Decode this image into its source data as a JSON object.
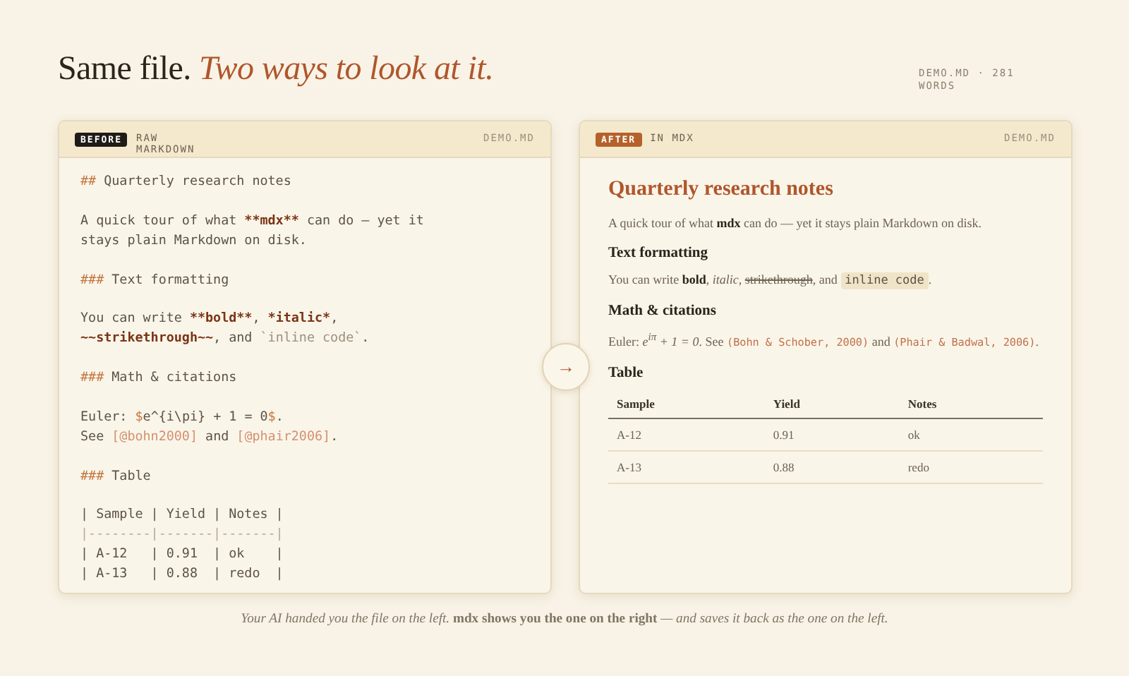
{
  "title": {
    "plain": "Same file.",
    "accent": "Two ways to look at it."
  },
  "meta": "DEMO.MD · 281 WORDS",
  "raw_panel": {
    "badge": {
      "text": "BEFORE",
      "kind": "before"
    },
    "label": "RAW MARKDOWN",
    "file": "DEMO.MD",
    "blocks": [
      {
        "lines": [
          [
            {
              "kind": "mark",
              "text": "## "
            },
            {
              "kind": "plain",
              "text": "Quarterly research notes"
            }
          ]
        ]
      },
      {
        "lines": [
          [
            {
              "kind": "plain",
              "text": "A quick tour of what "
            },
            {
              "kind": "strong",
              "text": "**mdx**"
            },
            {
              "kind": "plain",
              "text": " can do — yet it"
            }
          ],
          [
            {
              "kind": "plain",
              "text": "stays plain Markdown on disk."
            }
          ]
        ]
      },
      {
        "lines": [
          [
            {
              "kind": "mark",
              "text": "### "
            },
            {
              "kind": "plain",
              "text": "Text formatting"
            }
          ]
        ]
      },
      {
        "lines": [
          [
            {
              "kind": "plain",
              "text": "You can write "
            },
            {
              "kind": "strong",
              "text": "**bold**"
            },
            {
              "kind": "plain",
              "text": ", "
            },
            {
              "kind": "strong",
              "text": "*italic*"
            },
            {
              "kind": "plain",
              "text": ","
            }
          ],
          [
            {
              "kind": "strong",
              "text": "~~strikethrough~~"
            },
            {
              "kind": "plain",
              "text": ", and "
            },
            {
              "kind": "code",
              "text": "`inline code`"
            },
            {
              "kind": "plain",
              "text": "."
            }
          ]
        ]
      },
      {
        "lines": [
          [
            {
              "kind": "mark",
              "text": "### "
            },
            {
              "kind": "plain",
              "text": "Math & citations"
            }
          ]
        ]
      },
      {
        "lines": [
          [
            {
              "kind": "plain",
              "text": "Euler: "
            },
            {
              "kind": "mark",
              "text": "$"
            },
            {
              "kind": "plain",
              "text": "e^{i\\pi} + 1 = 0"
            },
            {
              "kind": "mark",
              "text": "$"
            },
            {
              "kind": "plain",
              "text": "."
            }
          ],
          [
            {
              "kind": "plain",
              "text": "See "
            },
            {
              "kind": "cite",
              "text": "[@bohn2000]"
            },
            {
              "kind": "plain",
              "text": " and "
            },
            {
              "kind": "cite",
              "text": "[@phair2006]"
            },
            {
              "kind": "plain",
              "text": "."
            }
          ]
        ]
      },
      {
        "lines": [
          [
            {
              "kind": "mark",
              "text": "### "
            },
            {
              "kind": "plain",
              "text": "Table"
            }
          ]
        ]
      },
      {
        "lines": [
          [
            {
              "kind": "plain",
              "text": "| Sample | Yield | Notes |"
            }
          ],
          [
            {
              "kind": "rule",
              "text": "|--------|-------|-------|"
            }
          ],
          [
            {
              "kind": "plain",
              "text": "| A-12   | 0.91  | ok    |"
            }
          ],
          [
            {
              "kind": "plain",
              "text": "| A-13   | 0.88  | redo  |"
            }
          ]
        ]
      }
    ]
  },
  "arrow": "→",
  "rendered_panel": {
    "badge": {
      "text": "AFTER",
      "kind": "after"
    },
    "label": "IN MDX",
    "file": "DEMO.MD",
    "heading": "Quarterly research notes",
    "blocks": [
      {
        "kind": "para",
        "parts": [
          {
            "kind": "text",
            "text": "A quick tour of what "
          },
          {
            "kind": "bold",
            "text": "mdx"
          },
          {
            "kind": "text",
            "text": " can do — yet it stays plain Markdown on disk."
          }
        ]
      },
      {
        "kind": "subheading",
        "text": "Text formatting"
      },
      {
        "kind": "para",
        "parts": [
          {
            "kind": "text",
            "text": "You can write "
          },
          {
            "kind": "bold",
            "text": "bold"
          },
          {
            "kind": "text",
            "text": ", "
          },
          {
            "kind": "italic",
            "text": "italic"
          },
          {
            "kind": "text",
            "text": ", "
          },
          {
            "kind": "strike",
            "text": "strikethrough"
          },
          {
            "kind": "text",
            "text": ", and "
          },
          {
            "kind": "code",
            "text": "inline code"
          },
          {
            "kind": "text",
            "text": "."
          }
        ]
      },
      {
        "kind": "subheading",
        "text": "Math & citations"
      },
      {
        "kind": "para",
        "parts": [
          {
            "kind": "text",
            "text": "Euler: "
          },
          {
            "kind": "math",
            "text": "e$^{iπ}$ + 1 = 0"
          },
          {
            "kind": "text",
            "text": ". See "
          },
          {
            "kind": "cite",
            "text": "(Bohn & Schober, 2000)"
          },
          {
            "kind": "text",
            "text": " and "
          },
          {
            "kind": "cite",
            "text": "(Phair & Badwal, 2006)"
          },
          {
            "kind": "text",
            "text": "."
          }
        ]
      },
      {
        "kind": "subheading",
        "text": "Table"
      }
    ],
    "table": {
      "columns": [
        "Sample",
        "Yield",
        "Notes"
      ],
      "rows": [
        [
          "A-12",
          "0.91",
          "ok"
        ],
        [
          "A-13",
          "0.88",
          "redo"
        ]
      ]
    }
  },
  "caption": "*Your AI handed you the file on the left.* **mdx shows you the one on the right** *— and saves it back as the one on the left.*"
}
